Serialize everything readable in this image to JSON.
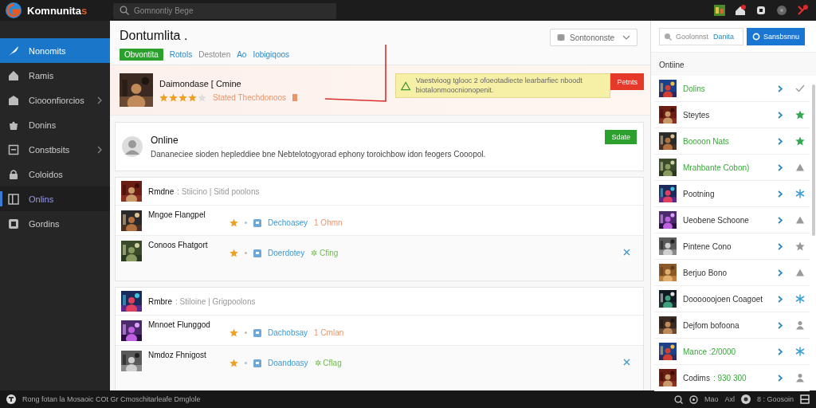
{
  "app": {
    "name": "Komnunita",
    "name_accent": "s"
  },
  "search": {
    "placeholder": "Gomnontiy Bege"
  },
  "top_icons": [
    {
      "badge": false
    },
    {
      "badge": true
    },
    {
      "badge": false
    },
    {
      "badge": false
    },
    {
      "badge": true
    }
  ],
  "sidebar": {
    "items": [
      {
        "label": "Nonomits",
        "kind": "link",
        "selected": true,
        "focused": false
      },
      {
        "label": "Ramis",
        "kind": "link",
        "selected": false,
        "focused": false
      },
      {
        "label": "Ciooonfiorcios",
        "kind": "group",
        "selected": false,
        "focused": false
      },
      {
        "label": "Donins",
        "kind": "link",
        "selected": false,
        "focused": false
      },
      {
        "label": "Constbsits",
        "kind": "group",
        "selected": false,
        "focused": false
      },
      {
        "label": "Coloidos",
        "kind": "link",
        "selected": false,
        "focused": false
      },
      {
        "label": "Onlins",
        "kind": "link",
        "selected": false,
        "focused": true
      },
      {
        "label": "Gordins",
        "kind": "link",
        "selected": false,
        "focused": false
      }
    ]
  },
  "header": {
    "title": "Dontumlita .",
    "dropdown": "Sontononste",
    "tabs": [
      {
        "label": "Obvontita",
        "selected": true,
        "disabled": false
      },
      {
        "label": "Rotols",
        "selected": false,
        "disabled": false
      },
      {
        "label": "Destoten",
        "selected": false,
        "disabled": true
      },
      {
        "label": "Ao",
        "selected": false,
        "disabled": false
      },
      {
        "label": "Iobigiqoos",
        "selected": false,
        "disabled": false
      }
    ]
  },
  "featured": {
    "title": "Daimondase [ Cmine",
    "stars": 4,
    "note": "Stated Thechdonoos",
    "warning": "Vaestvioog tglooc 2 ofoeotadiecte learbarfiec nboodt biotalonmoocnionopenit.",
    "button": "Petnts"
  },
  "card": {
    "title": "Online",
    "text": "Dananeciee sioden hepleddiee bne Nebtelotogyorad ephony toroichbow idon feogers Cooopol.",
    "button": "Sdate"
  },
  "groups": [
    {
      "title": "Rmdne",
      "subtitle": ": Stiicino | Sitid poolons",
      "items": [
        {
          "name": "Mngoe Flangpel",
          "link": "Dechoasey",
          "note": "1 Ohmn",
          "color": "#e8956a",
          "closable": false
        },
        {
          "name": "Conoos Fhatgort",
          "link": "Doerdotey",
          "note": "✲ Cfing",
          "color": "#6dbb4a",
          "closable": true
        }
      ]
    },
    {
      "title": "Rmbre",
      "subtitle": ": Stiloine | Grigpoolons",
      "items": [
        {
          "name": "Mnnoet Flunggod",
          "link": "Dachobsay",
          "note": "1 Cmlan",
          "color": "#e8956a",
          "closable": false
        },
        {
          "name": "Nmdoz Fhnigost",
          "link": "Doandoasy",
          "note": "✲ Cflag",
          "color": "#6dbb4a",
          "closable": true
        }
      ]
    }
  ],
  "side_panel": {
    "search_placeholder": "Goolonnst",
    "search_link": "Danita",
    "button": "Sansbsnnu",
    "heading": "Ontiine",
    "items": [
      {
        "name": "Dolins",
        "online": true,
        "kind": "check",
        "color": "#9a9a9a"
      },
      {
        "name": "Steytes",
        "online": false,
        "kind": "star",
        "color": "#2fa84f"
      },
      {
        "name": "Boooon Nats",
        "online": true,
        "kind": "star",
        "color": "#2fa84f"
      },
      {
        "name": "Mrahbante Cobon)",
        "online": true,
        "kind": "triangle",
        "color": "#9a9a9a"
      },
      {
        "name": "Pootning",
        "online": false,
        "kind": "spark",
        "color": "#3aa0d8"
      },
      {
        "name": "Ueobene Schoone",
        "online": false,
        "kind": "triangle",
        "color": "#9a9a9a"
      },
      {
        "name": "Pintene Cono",
        "online": false,
        "kind": "star",
        "color": "#9a9a9a"
      },
      {
        "name": "Berjuo Bono",
        "online": false,
        "kind": "triangle",
        "color": "#9a9a9a"
      },
      {
        "name": "Doooooojoen Coagoet",
        "online": false,
        "kind": "spark",
        "color": "#3aa0d8"
      },
      {
        "name": "Dejfom bofoona",
        "online": false,
        "kind": "person",
        "color": "#9a9a9a"
      },
      {
        "name": "Mance :2/0000",
        "online": true,
        "kind": "spark",
        "color": "#3aa0d8"
      },
      {
        "name": "Codims",
        "detail": ": 930 300",
        "online": false,
        "kind": "person",
        "color": "#9a9a9a"
      }
    ]
  },
  "status_bar": {
    "text": "Rong fotan la Mosaoic COt Gr Cmoschitarleafe Dmglole",
    "right": [
      "Mao",
      "Axl",
      "8 : Goosoin"
    ]
  }
}
